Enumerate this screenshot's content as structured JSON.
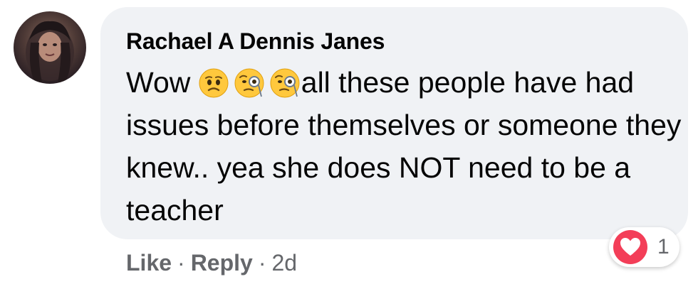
{
  "comment": {
    "author": "Rachael A Dennis Janes",
    "text_before": "Wow ",
    "emojis": [
      "anxious-face-emoji",
      "face-with-monocle-emoji",
      "face-with-monocle-emoji"
    ],
    "text_after": "all these people have had issues before themselves or someone they knew.. yea she does NOT need to be a teacher"
  },
  "actions": {
    "like_label": "Like",
    "reply_label": "Reply",
    "separator": "·",
    "timestamp": "2d"
  },
  "reactions": {
    "icon": "heart-icon",
    "count": "1",
    "heart_color": "#f33e58"
  },
  "colors": {
    "bubble_bg": "#f0f2f5",
    "text": "#050505",
    "secondary_text": "#65676b"
  }
}
